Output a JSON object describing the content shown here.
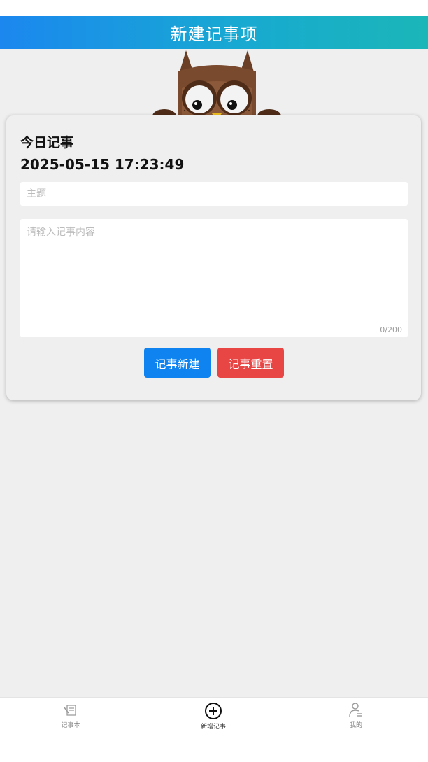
{
  "header": {
    "title": "新建记事项"
  },
  "card": {
    "heading": "今日记事",
    "datetime": "2025-05-15 17:23:49",
    "subject_placeholder": "主题",
    "content_placeholder": "请输入记事内容",
    "char_counter": "0/200",
    "create_button": "记事新建",
    "reset_button": "记事重置"
  },
  "tabbar": {
    "items": [
      {
        "label": "记事本",
        "icon": "notebook-icon"
      },
      {
        "label": "新增记事",
        "icon": "plus-circle-icon"
      },
      {
        "label": "我的",
        "icon": "user-icon"
      }
    ]
  },
  "colors": {
    "header_gradient_start": "#1b87ef",
    "header_gradient_end": "#1ab6b8",
    "create_button": "#0f84f0",
    "reset_button": "#e84545",
    "background": "#efefef"
  }
}
